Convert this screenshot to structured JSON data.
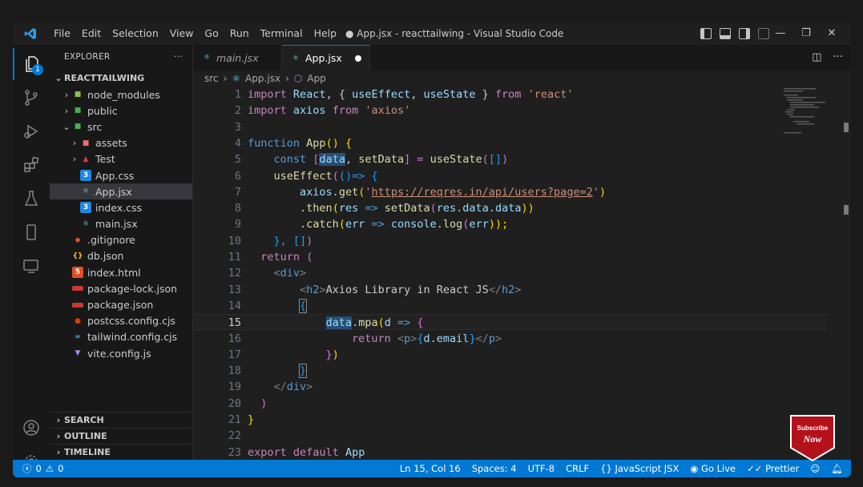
{
  "titlebar": {
    "menu": [
      "File",
      "Edit",
      "Selection",
      "View",
      "Go",
      "Run",
      "Terminal",
      "Help"
    ],
    "title": "● App.jsx - reacttailwing - Visual Studio Code",
    "controls": [
      "—",
      "❐",
      "✕"
    ]
  },
  "activity": {
    "badge": "1"
  },
  "sidebar": {
    "header": "EXPLORER",
    "more": "···",
    "root": "REACTTAILWING",
    "items": [
      {
        "label": "node_modules",
        "chev": "›",
        "icon": "folder-node"
      },
      {
        "label": "public",
        "chev": "›",
        "icon": "folder-public"
      },
      {
        "label": "src",
        "chev": "⌄",
        "icon": "folder-src"
      },
      {
        "label": "assets",
        "chev": "›",
        "icon": "folder-assets"
      },
      {
        "label": "Test",
        "chev": "›",
        "icon": "folder-test"
      },
      {
        "label": "App.css",
        "chev": "",
        "icon": "css"
      },
      {
        "label": "App.jsx",
        "chev": "",
        "icon": "react"
      },
      {
        "label": "index.css",
        "chev": "",
        "icon": "css"
      },
      {
        "label": "main.jsx",
        "chev": "",
        "icon": "react"
      },
      {
        "label": ".gitignore",
        "chev": "",
        "icon": "git"
      },
      {
        "label": "db.json",
        "chev": "",
        "icon": "json"
      },
      {
        "label": "index.html",
        "chev": "",
        "icon": "html"
      },
      {
        "label": "package-lock.json",
        "chev": "",
        "icon": "npm"
      },
      {
        "label": "package.json",
        "chev": "",
        "icon": "npm"
      },
      {
        "label": "postcss.config.cjs",
        "chev": "",
        "icon": "postcss"
      },
      {
        "label": "tailwind.config.cjs",
        "chev": "",
        "icon": "tailwind"
      },
      {
        "label": "vite.config.js",
        "chev": "",
        "icon": "vite"
      }
    ],
    "sections": [
      "SEARCH",
      "OUTLINE",
      "TIMELINE"
    ]
  },
  "tabs": [
    {
      "label": "main.jsx",
      "active": false
    },
    {
      "label": "App.jsx",
      "active": true
    }
  ],
  "breadcrumb": {
    "folder": "src",
    "sep": "›",
    "file": "App.jsx",
    "symbol": "App"
  },
  "code": {
    "current_line": 15,
    "line_numbers": [
      "1",
      "2",
      "3",
      "4",
      "5",
      "6",
      "7",
      "8",
      "9",
      "10",
      "11",
      "12",
      "13",
      "14",
      "15",
      "16",
      "17",
      "18",
      "19",
      "20",
      "21",
      "22",
      "23"
    ],
    "l1": {
      "a": "import",
      "b": "React",
      "c": ", { ",
      "d": "useEffect",
      "e": ", ",
      "f": "useState",
      "g": " } ",
      "h": "from",
      "i": "'react'"
    },
    "l2": {
      "a": "import",
      "b": "axios",
      "c": "from",
      "d": "'axios'"
    },
    "l4": {
      "a": "function",
      "b": "App",
      "c": "() {"
    },
    "l5": {
      "a": "const",
      "b": "[",
      "c": "data",
      "d": ", ",
      "e": "setData",
      "f": "] = ",
      "g": "useState",
      "h": "(",
      "i": "[]",
      "j": ")"
    },
    "l6": {
      "a": "useEffect",
      "b": "(",
      "c": "()",
      "d": "=> {"
    },
    "l7": {
      "a": "axios",
      "b": ".",
      "c": "get",
      "d": "(",
      "e": "'",
      "f": "https://reqres.in/api/users?page=2",
      "g": "'",
      "h": ")"
    },
    "l8": {
      "a": ".",
      "b": "then",
      "c": "(",
      "d": "res",
      "e": " => ",
      "f": "setData",
      "g": "(",
      "h": "res",
      "i": ".data.data",
      "j": "))"
    },
    "l9": {
      "a": ".",
      "b": "catch",
      "c": "(",
      "d": "err",
      "e": " => ",
      "f": "console",
      "g": ".",
      "h": "log",
      "i": "(",
      "j": "err",
      "k": "));"
    },
    "l10": {
      "a": "}, ",
      "b": "[]",
      "c": ")"
    },
    "l11": {
      "a": "return",
      "b": "("
    },
    "l12": {
      "a": "<",
      "b": "div",
      "c": ">"
    },
    "l13": {
      "a": "<",
      "b": "h2",
      "c": ">",
      "d": "Axios Library in React JS",
      "e": "</",
      "f": "h2",
      "g": ">"
    },
    "l14": {
      "a": "{"
    },
    "l15": {
      "a": "data",
      "b": ".",
      "c": "mpa",
      "d": "(",
      "e": "d",
      "f": " => ",
      "g": "{"
    },
    "l16": {
      "a": "return",
      "b": "<",
      "c": "p",
      "d": ">",
      "e": "{",
      "f": "d",
      "g": ".email",
      "h": "}",
      "i": "</",
      "j": "p",
      "k": ">"
    },
    "l17": {
      "a": "}",
      "b": ")"
    },
    "l18": {
      "a": "}"
    },
    "l19": {
      "a": "</",
      "b": "div",
      "c": ">"
    },
    "l20": {
      "a": ")"
    },
    "l21": {
      "a": "}"
    },
    "l23": {
      "a": "export",
      "b": "default",
      "c": "App"
    }
  },
  "statusbar": {
    "errors": "0",
    "warnings": "0",
    "position": "Ln 15, Col 16",
    "spaces": "Spaces: 4",
    "encoding": "UTF-8",
    "eol": "CRLF",
    "language": "JavaScript JSX",
    "golive": "Go Live",
    "prettier": "Prettier"
  },
  "overlay": {
    "subscribe_top": "Subscribe",
    "subscribe_bottom": "Now"
  },
  "colors": {
    "accent": "#0078d4",
    "status": "#0078d4",
    "subscribe": "#b3121b"
  }
}
